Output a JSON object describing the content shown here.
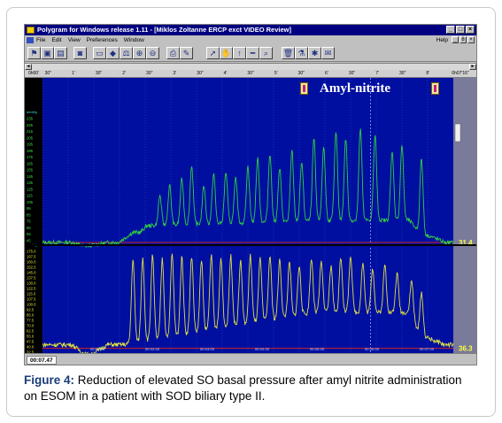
{
  "window": {
    "title": "Polygram for Windows release 1.11 - [Miklos Zoltanne ERCP exct VIDEO Review]",
    "controls": [
      "_",
      "□",
      "×"
    ]
  },
  "menubar": {
    "items": [
      "File",
      "Edit",
      "View",
      "Preferences",
      "Window"
    ],
    "help": "Help",
    "mdi_controls": [
      "_",
      "8",
      "×"
    ]
  },
  "toolbar": {
    "icons": [
      "patient-icon",
      "save-icon",
      "folder-icon",
      "disk-icon",
      "window-icon",
      "diamond-icon",
      "scale-icon",
      "zoom-in-icon",
      "zoom-out-icon",
      "printer-icon",
      "edit-icon",
      "pointer-icon",
      "hand-icon",
      "marker-icon",
      "ruler-icon",
      "search-icon",
      "trash-icon",
      "flask-icon",
      "pepper-icon",
      "note-icon"
    ]
  },
  "ruler": {
    "ticks": [
      "0h00'",
      "30\"",
      "1'",
      "30\"",
      "2'",
      "30\"",
      "3'",
      "30\"",
      "4'",
      "30\"",
      "5'",
      "30\"",
      "6'",
      "30\"",
      "7'",
      "30\"",
      "8'",
      "0h07'16\""
    ]
  },
  "annotation": {
    "text": "Amyl-nitrite"
  },
  "status": {
    "time": "00:07.47"
  },
  "chart_data": {
    "type": "line",
    "background": "#000fa0",
    "channels": [
      {
        "name": "",
        "color": "#2fd040",
        "unit": "mmHg",
        "yticks": [
          235,
          225,
          215,
          205,
          195,
          185,
          175,
          165,
          155,
          145,
          135,
          125,
          115,
          105,
          95,
          85,
          75,
          65,
          55,
          45
        ],
        "baseline_label": "31.4",
        "phases": [
          {
            "t_end": 12,
            "base": 45
          },
          {
            "t_end": 19,
            "base": 40
          },
          {
            "t_end": 31,
            "base": 45
          },
          {
            "t_end": 40,
            "base": 60
          },
          {
            "t_end": 44,
            "base": 70
          },
          {
            "t_end": 150,
            "base": 78
          },
          {
            "t_end": 158,
            "base": 55
          },
          {
            "t_end": 168,
            "base": 45
          }
        ],
        "peaks": [
          [
            48,
            115
          ],
          [
            52,
            130
          ],
          [
            57,
            140
          ],
          [
            61,
            160
          ],
          [
            66,
            130
          ],
          [
            70,
            148
          ],
          [
            75,
            150
          ],
          [
            79,
            140
          ],
          [
            84,
            158
          ],
          [
            88,
            170
          ],
          [
            93,
            178
          ],
          [
            97,
            155
          ],
          [
            102,
            182
          ],
          [
            106,
            165
          ],
          [
            111,
            200
          ],
          [
            115,
            188
          ],
          [
            120,
            210
          ],
          [
            124,
            200
          ],
          [
            130,
            215
          ],
          [
            136,
            205
          ],
          [
            143,
            180
          ],
          [
            147,
            190
          ],
          [
            155,
            170
          ]
        ]
      },
      {
        "name": "",
        "color": "#e0e040",
        "unit": "mmHg",
        "yticks": [
          175.0,
          167.5,
          160.0,
          152.5,
          145.0,
          137.5,
          130.0,
          122.5,
          115.0,
          107.5,
          100.0,
          92.5,
          85.0,
          77.5,
          70.0,
          62.5,
          55.0,
          47.5,
          40.0,
          32.5
        ],
        "baseline_label": "36.3",
        "xtick_labels": [
          "00:01:00",
          "00:02:00",
          "00:03:00",
          "00:04:00",
          "00:05:00",
          "00:06:00",
          "00:07:00"
        ],
        "phases": [
          {
            "t_end": 12,
            "base": 45
          },
          {
            "t_end": 20,
            "base": 32
          },
          {
            "t_end": 30,
            "base": 45
          },
          {
            "t_end": 33,
            "base": 45
          },
          {
            "t_end": 150,
            "base": 88
          },
          {
            "t_end": 157,
            "base": 55
          },
          {
            "t_end": 168,
            "base": 45
          }
        ],
        "peaks": [
          [
            37,
            160
          ],
          [
            41,
            162
          ],
          [
            45,
            165
          ],
          [
            49,
            160
          ],
          [
            53,
            166
          ],
          [
            57,
            162
          ],
          [
            61,
            164
          ],
          [
            65,
            158
          ],
          [
            69,
            165
          ],
          [
            73,
            160
          ],
          [
            77,
            164
          ],
          [
            81,
            158
          ],
          [
            85,
            165
          ],
          [
            89,
            160
          ],
          [
            93,
            164
          ],
          [
            97,
            158
          ],
          [
            101,
            155
          ],
          [
            105,
            150
          ],
          [
            110,
            160
          ],
          [
            114,
            156
          ],
          [
            118,
            150
          ],
          [
            122,
            162
          ],
          [
            126,
            165
          ],
          [
            131,
            155
          ],
          [
            135,
            148
          ],
          [
            140,
            152
          ],
          [
            145,
            140
          ],
          [
            151,
            130
          ],
          [
            155,
            115
          ]
        ]
      }
    ],
    "x_range_s": [
      0,
      467
    ],
    "event_time_s": 373
  },
  "caption": {
    "label": "Figure 4:",
    "text": "Reduction of elevated SO basal pressure after amyl nitrite administration on ESOM in a patient with SOD biliary type II."
  }
}
